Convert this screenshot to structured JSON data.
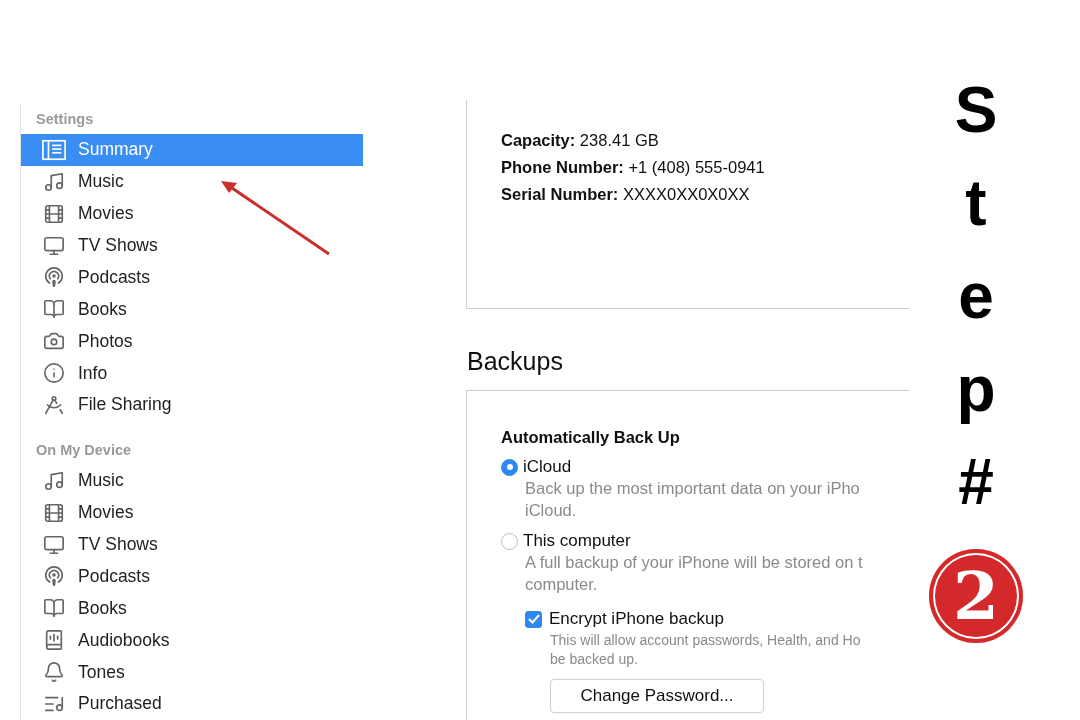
{
  "sidebar": {
    "sections": [
      {
        "title": "Settings",
        "items": [
          {
            "label": "Summary",
            "kind": "summary",
            "selected": true
          },
          {
            "label": "Music",
            "kind": "music",
            "selected": false
          },
          {
            "label": "Movies",
            "kind": "film",
            "selected": false
          },
          {
            "label": "TV Shows",
            "kind": "tv",
            "selected": false
          },
          {
            "label": "Podcasts",
            "kind": "podcast",
            "selected": false
          },
          {
            "label": "Books",
            "kind": "book",
            "selected": false
          },
          {
            "label": "Photos",
            "kind": "camera",
            "selected": false
          },
          {
            "label": "Info",
            "kind": "info",
            "selected": false
          },
          {
            "label": "File Sharing",
            "kind": "apps",
            "selected": false
          }
        ]
      },
      {
        "title": "On My Device",
        "items": [
          {
            "label": "Music",
            "kind": "music",
            "selected": false
          },
          {
            "label": "Movies",
            "kind": "film",
            "selected": false
          },
          {
            "label": "TV Shows",
            "kind": "tv",
            "selected": false
          },
          {
            "label": "Podcasts",
            "kind": "podcast",
            "selected": false
          },
          {
            "label": "Books",
            "kind": "book",
            "selected": false
          },
          {
            "label": "Audiobooks",
            "kind": "audiobook",
            "selected": false
          },
          {
            "label": "Tones",
            "kind": "bell",
            "selected": false
          },
          {
            "label": "Purchased",
            "kind": "list",
            "selected": false
          }
        ]
      }
    ]
  },
  "summary": {
    "fields": [
      "**Capacity:** 238.41 GB",
      "**Phone Number:** +1 (408) 555-0941",
      "**Serial Number:** XXXX0XX0X0XX"
    ]
  },
  "backups": {
    "heading": "Backups",
    "group_title": "Automatically Back Up",
    "options": [
      {
        "label": "iCloud",
        "selected": true,
        "description": [
          "Back up the most important data on your iPho",
          "iCloud."
        ]
      },
      {
        "label": "This computer",
        "selected": false,
        "description": [
          "A full backup of your iPhone will be stored on t",
          "computer."
        ]
      }
    ],
    "encrypt": {
      "label": "Encrypt iPhone backup",
      "checked": true,
      "description": [
        "This will allow account passwords, Health, and Ho",
        "be backed up."
      ]
    },
    "button": "Change Password..."
  },
  "step": {
    "title": "Step#",
    "number": "2"
  }
}
